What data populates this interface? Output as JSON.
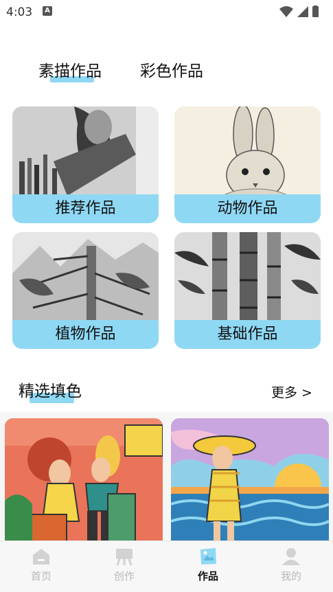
{
  "status_bar": {
    "time": "4:03",
    "notif_icon": "A"
  },
  "tabs": [
    {
      "label": "素描作品",
      "active": true
    },
    {
      "label": "彩色作品",
      "active": false
    }
  ],
  "categories": [
    {
      "label": "推荐作品",
      "image": "sketch-artist-drawing"
    },
    {
      "label": "动物作品",
      "image": "sketch-rabbit"
    },
    {
      "label": "植物作品",
      "image": "sketch-tree"
    },
    {
      "label": "基础作品",
      "image": "sketch-bamboo"
    }
  ],
  "featured": {
    "title": "精选填色",
    "more_label": "更多 >",
    "items": [
      {
        "image": "colored-two-girls-travel"
      },
      {
        "image": "colored-girl-beach-sunhat"
      }
    ]
  },
  "bottom_nav": [
    {
      "label": "首页",
      "icon": "home-icon",
      "active": false
    },
    {
      "label": "创作",
      "icon": "easel-icon",
      "active": false
    },
    {
      "label": "作品",
      "icon": "gallery-icon",
      "active": true
    },
    {
      "label": "我的",
      "icon": "profile-icon",
      "active": false
    }
  ],
  "colors": {
    "accent": "#8fd8f4",
    "nav_inactive": "#b8b8b8"
  }
}
